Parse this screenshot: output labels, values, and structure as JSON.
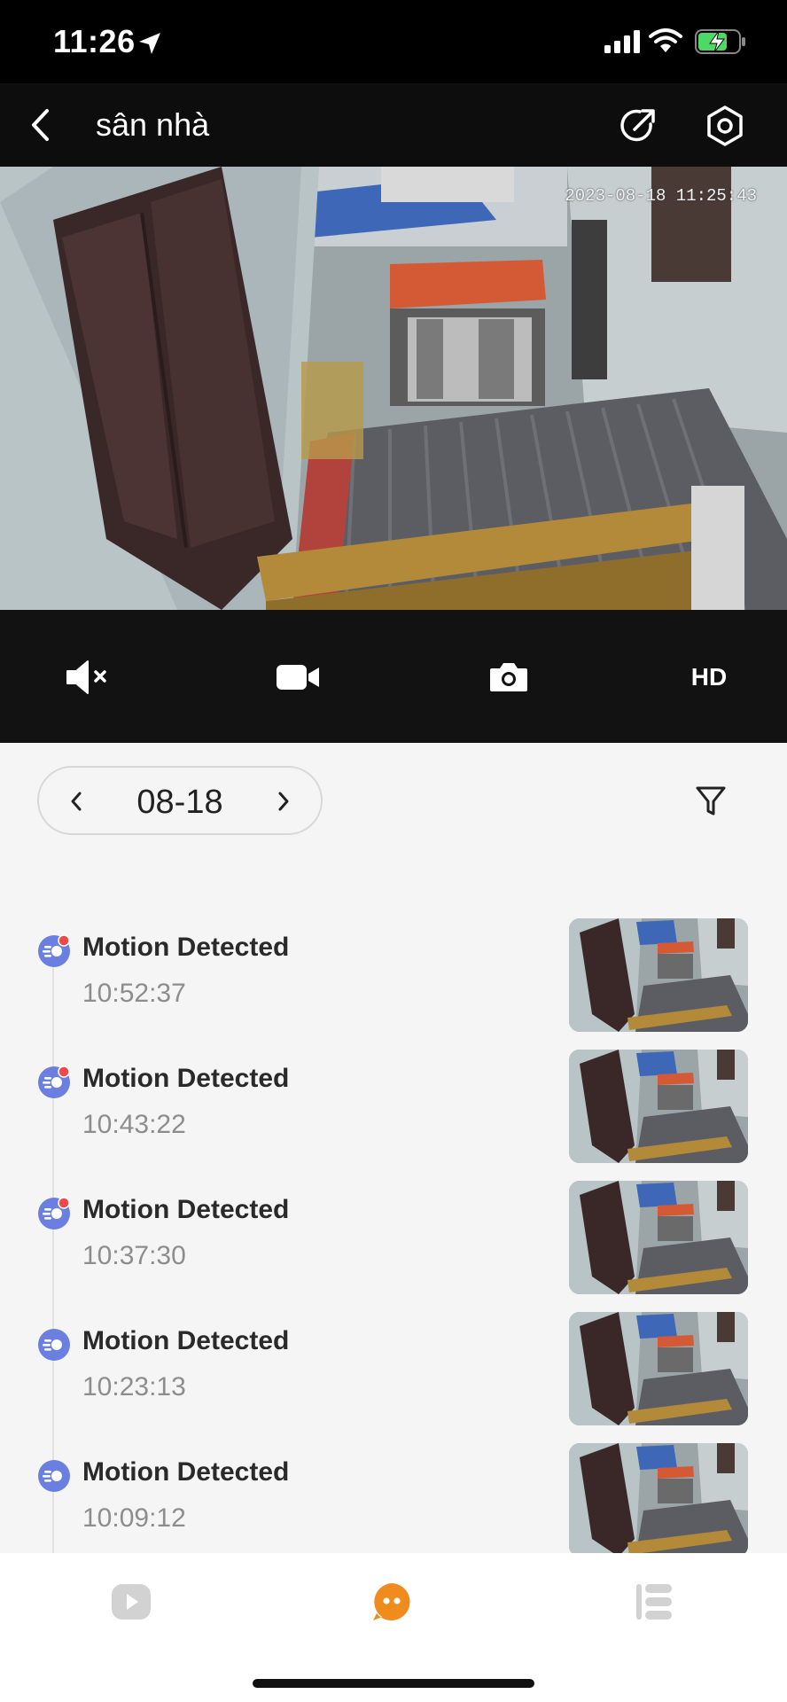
{
  "status_bar": {
    "time": "11:26",
    "icons": [
      "location-arrow-icon",
      "cellular-signal-icon",
      "wifi-icon",
      "battery-charging-icon"
    ]
  },
  "header": {
    "title": "sân nhà",
    "icons": [
      "back-chevron-icon",
      "share-icon",
      "settings-icon"
    ]
  },
  "video": {
    "timestamp": "2023-08-18 11:25:43"
  },
  "controls": {
    "icons": [
      "mute-icon",
      "record-icon",
      "snapshot-icon"
    ],
    "quality_label": "HD"
  },
  "date_picker": {
    "date": "08-18",
    "icons": [
      "prev-chevron-icon",
      "next-chevron-icon",
      "filter-icon"
    ]
  },
  "events": [
    {
      "title": "Motion Detected",
      "time": "10:52:37",
      "unread": true
    },
    {
      "title": "Motion Detected",
      "time": "10:43:22",
      "unread": true
    },
    {
      "title": "Motion Detected",
      "time": "10:37:30",
      "unread": true
    },
    {
      "title": "Motion Detected",
      "time": "10:23:13",
      "unread": false
    },
    {
      "title": "Motion Detected",
      "time": "10:09:12",
      "unread": false
    }
  ],
  "bottom_nav": {
    "icons": [
      "playback-icon",
      "messages-icon",
      "list-icon"
    ],
    "active": "messages-icon"
  },
  "colors": {
    "accent": "#f08c1e",
    "event_icon": "#6b7fe0",
    "unread_dot": "#f04848",
    "header_bg": "#0d0d0d",
    "controls_bg": "#121212"
  }
}
